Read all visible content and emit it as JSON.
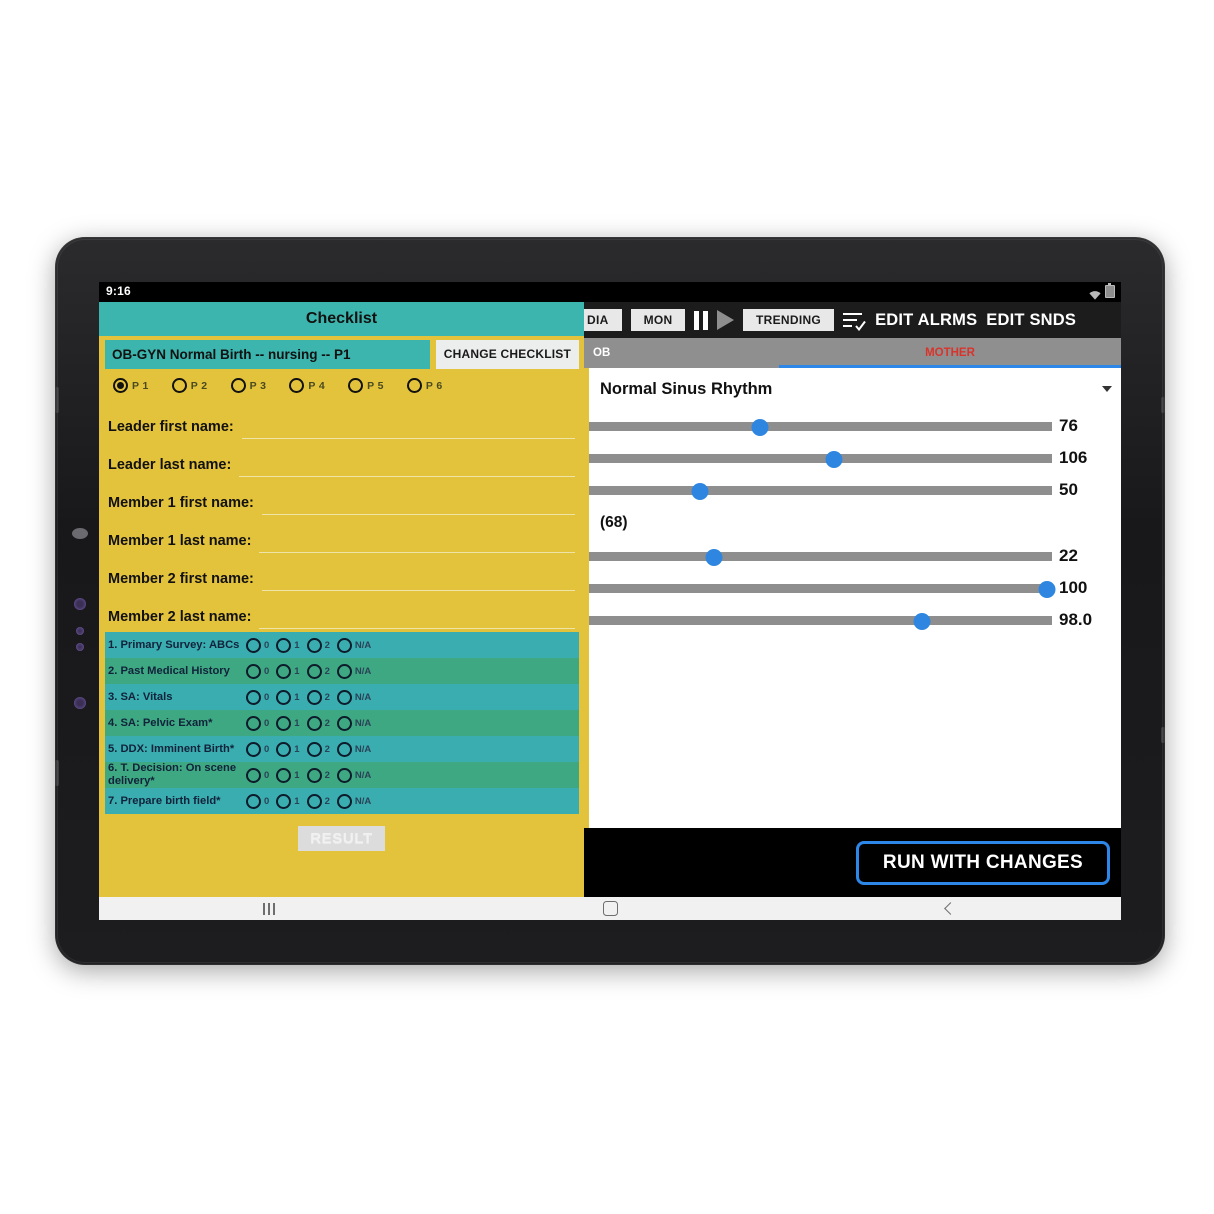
{
  "status_bar": {
    "time": "9:16",
    "icons": [
      "wifi-icon",
      "battery-icon"
    ]
  },
  "checklist_app": {
    "title": "Checklist",
    "selected_checklist": "OB-GYN Normal Birth -- nursing -- P1",
    "change_checklist_label": "CHANGE CHECKLIST",
    "phases": [
      {
        "label": "P 1",
        "selected": true
      },
      {
        "label": "P 2",
        "selected": false
      },
      {
        "label": "P 3",
        "selected": false
      },
      {
        "label": "P 4",
        "selected": false
      },
      {
        "label": "P 5",
        "selected": false
      },
      {
        "label": "P 6",
        "selected": false
      }
    ],
    "fields": [
      {
        "label": "Leader first name:",
        "value": "",
        "placeholder": ""
      },
      {
        "label": "Leader last name:",
        "value": "",
        "placeholder": ""
      },
      {
        "label": "Member 1 first name:",
        "value": "",
        "placeholder": ""
      },
      {
        "label": "Member 1 last name:",
        "value": "",
        "placeholder": ""
      },
      {
        "label": "Member 2 first name:",
        "value": "",
        "placeholder": ""
      },
      {
        "label": "Member 2 last name:",
        "value": "",
        "placeholder": ""
      }
    ],
    "score_options": [
      "0",
      "1",
      "2",
      "N/A"
    ],
    "items": [
      {
        "label": "1. Primary Survey: ABCs"
      },
      {
        "label": "2. Past Medical History"
      },
      {
        "label": "3. SA: Vitals"
      },
      {
        "label": "4. SA: Pelvic Exam*"
      },
      {
        "label": "5. DDX:  Imminent Birth*"
      },
      {
        "label": "6. T. Decision: On scene delivery*"
      },
      {
        "label": "7. Prepare birth field*"
      }
    ],
    "result_label": "RESULT",
    "colors": {
      "header_teal": "#3bb5ad",
      "panel_yellow": "#e3c23c",
      "row_odd": "#3aadb0",
      "row_even": "#3ea882"
    }
  },
  "simulator_app": {
    "toolbar": {
      "media_label": "DIA",
      "mon_label": "MON",
      "pause_icon": "pause-icon",
      "play_icon": "play-icon",
      "trending_label": "TRENDING",
      "checklist_icon": "list-check-icon",
      "edit_alarms_label": "EDIT ALRMS",
      "edit_sounds_label": "EDIT SNDS"
    },
    "tabs": [
      {
        "label": "OB",
        "selected": false
      },
      {
        "label": "MOTHER",
        "selected": true
      }
    ],
    "rhythm": "Normal Sinus Rhythm",
    "rhythm_caret_icon": "chevron-down-icon",
    "paren_value": "(68)",
    "vitals": [
      {
        "value": "76",
        "percent": 37
      },
      {
        "value": "106",
        "percent": 53
      },
      {
        "value": "50",
        "percent": 24
      },
      {
        "value": "22",
        "percent": 27
      },
      {
        "value": "100",
        "percent": 99
      },
      {
        "value": "98.0",
        "percent": 72
      }
    ],
    "run_label": "RUN WITH CHANGES",
    "colors": {
      "accent_blue": "#2d87e8",
      "tab_bar_gray": "#8f8f8f",
      "mother_red": "#d8342c",
      "slider_track": "#8e8e8e"
    }
  },
  "nav_bar": {
    "recents": "recents-icon",
    "home": "home-icon",
    "back": "back-icon"
  }
}
